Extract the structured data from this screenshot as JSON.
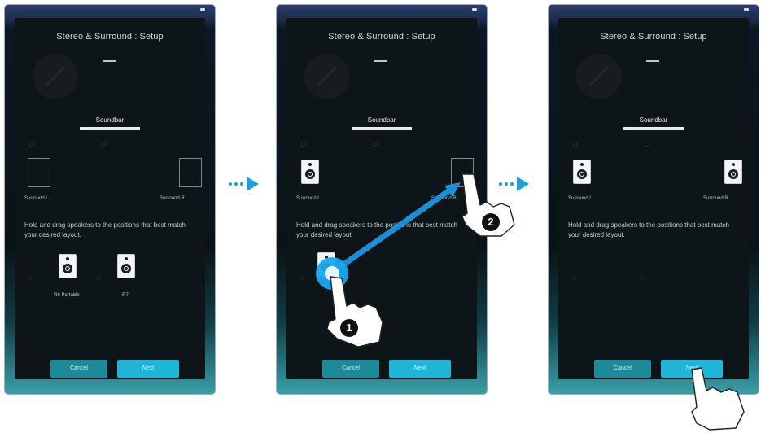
{
  "dialog_title": "Stereo & Surround : Setup",
  "top_value": "",
  "sub_label": "",
  "soundbar_label": "Soundbar",
  "slot_left_label": "Surround L",
  "slot_right_label": "Surround R",
  "instruction": "Hold and drag speakers to the positions that best match your desired layout.",
  "speaker_1_label": "R6 Portable",
  "speaker_2_label": "R7",
  "cancel_label": "Cancel",
  "next_label": "Next",
  "footer_left": "",
  "footer_right": "",
  "step_1": "1",
  "step_2": "2",
  "colors": {
    "accent": "#1fb5d8",
    "cancel": "#1c8a98",
    "arrow": "#1a9fe0",
    "panel": "#0e1518"
  },
  "icons": [
    "speaker-icon",
    "hand-pointer-icon",
    "chevron-right-icon"
  ]
}
